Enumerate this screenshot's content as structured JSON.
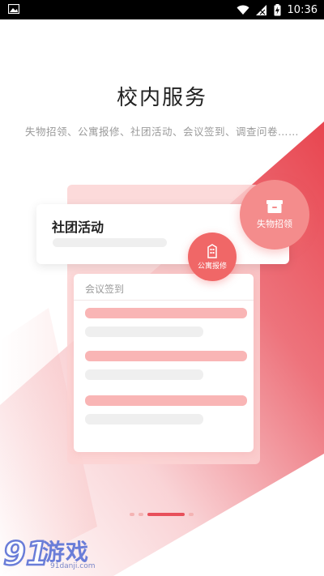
{
  "status_bar": {
    "time": "10:36"
  },
  "page": {
    "title": "校内服务",
    "subtitle": "失物招领、公寓报修、社团活动、会议签到、调查问卷……"
  },
  "cards": {
    "activity_label": "社团活动",
    "signin_label": "会议签到"
  },
  "badges": {
    "lost_found": "失物招领",
    "apartment_repair": "公寓报修"
  },
  "pager": {
    "total": 4,
    "active_index": 2
  },
  "watermark": {
    "brand": "游戏",
    "url": "91danji.com"
  },
  "colors": {
    "accent": "#e8505b",
    "accent_light": "#f48c8c",
    "badge_dark": "#f06767",
    "pink_bar": "#f9b5b5"
  },
  "icons": {
    "status_image": "image-icon",
    "wifi": "wifi-icon",
    "signal": "signal-icon",
    "battery": "battery-charging-icon",
    "lost_found": "box-icon",
    "apartment": "building-icon"
  }
}
